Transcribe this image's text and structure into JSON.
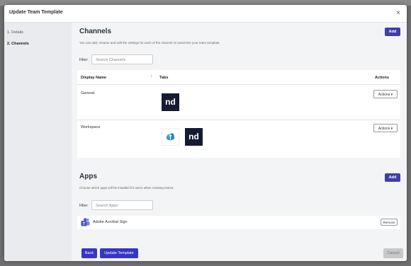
{
  "modal": {
    "title": "Update Team Template",
    "close_label": "×"
  },
  "sidebar": {
    "steps": [
      {
        "label": "1.  Details"
      },
      {
        "label": "2.  Channels"
      }
    ]
  },
  "channels": {
    "title": "Channels",
    "add_label": "Add",
    "description": "You can add, rename and edit the settings for each of the channel ot customize your team template.",
    "filter_label": "Filter:",
    "search_placeholder": "Search Channels",
    "columns": {
      "name": "Display Name",
      "sort": "↑",
      "tabs": "Tabs",
      "actions": "Actions"
    },
    "rows": [
      {
        "name": "General",
        "actions_label": "Actions ▾",
        "tab_logo": "nd"
      },
      {
        "name": "Workspace",
        "actions_label": "Actions ▾",
        "tab_logo": "nd"
      }
    ]
  },
  "apps": {
    "title": "Apps",
    "add_label": "Add",
    "description": "Choose which apps will be installed for users when creating teams.",
    "filter_label": "Filter:",
    "search_placeholder": "Search Apps",
    "items": [
      {
        "name": "Adobe Acrobat Sign",
        "remove_label": "Remove"
      }
    ]
  },
  "footer": {
    "back_label": "Back",
    "update_label": "Update Template",
    "cancel_label": "Cancel"
  },
  "colors": {
    "primary": "#3535c8",
    "add_button": "#3f3fa8",
    "nd_logo_bg": "#161b33",
    "teams_purple": "#5059c9"
  }
}
